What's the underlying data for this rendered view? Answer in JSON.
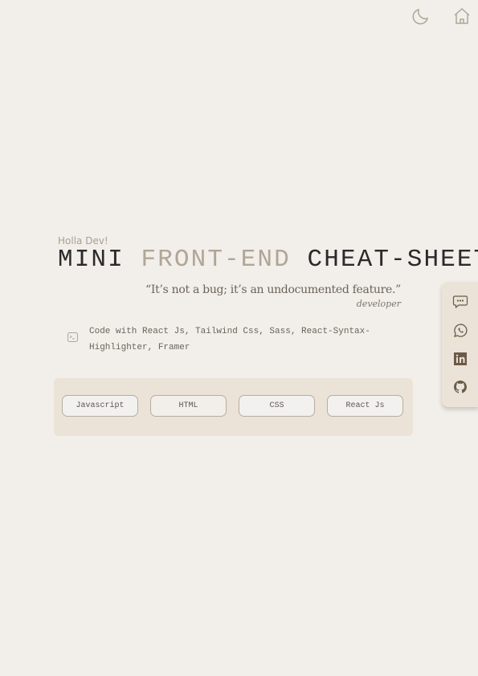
{
  "header": {
    "icons": [
      "moon-icon",
      "home-icon"
    ]
  },
  "hero": {
    "greeting": "Holla Dev!",
    "title_part1": "MINI",
    "title_part2": "FRONT-END",
    "title_part3": "CHEAT-SHEET",
    "quote": "“It’s not a bug; it’s an undocumented feature.”",
    "quote_author": "developer",
    "tech_stack": "Code with React Js, Tailwind Css, Sass, React-Syntax-Highlighter, Framer"
  },
  "topics": [
    "Javascript",
    "HTML",
    "CSS",
    "React Js"
  ],
  "social": [
    "chat-icon",
    "whatsapp-icon",
    "linkedin-icon",
    "github-icon"
  ],
  "colors": {
    "background": "#f2eeea",
    "panel": "#ebe3d7",
    "accent": "#b0a695",
    "icon": "#6b5a47"
  }
}
